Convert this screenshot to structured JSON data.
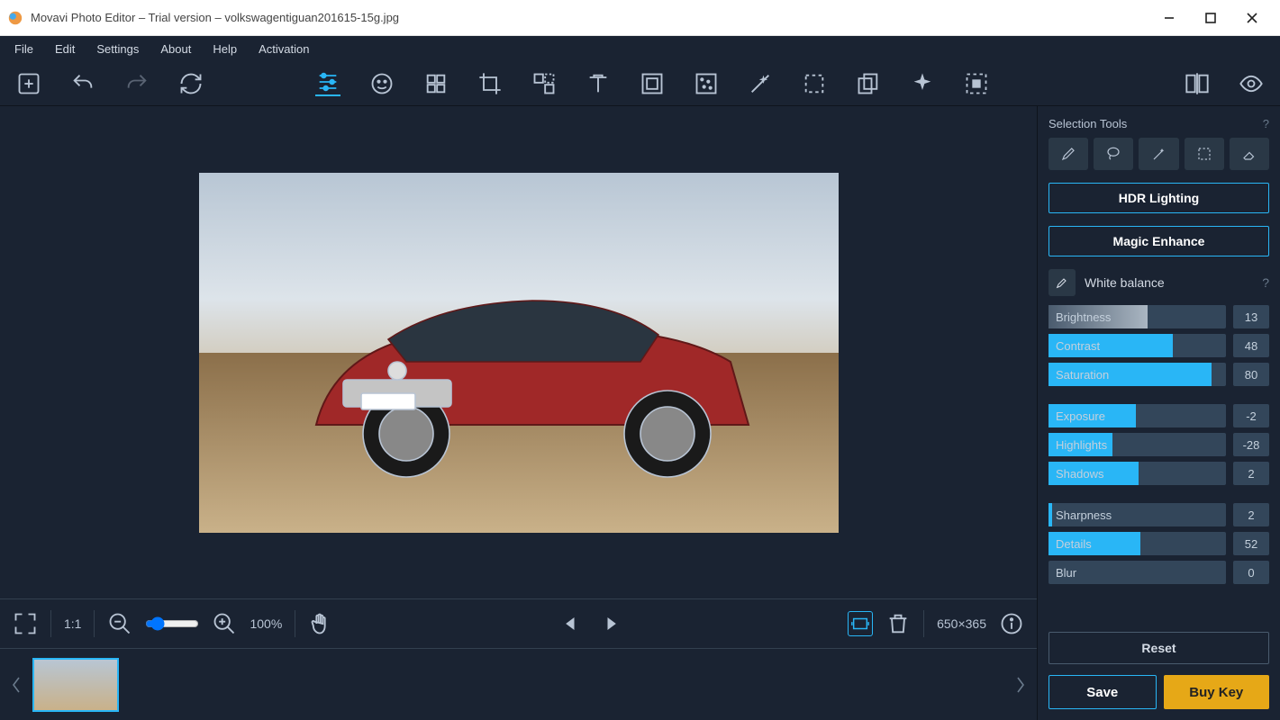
{
  "title": "Movavi Photo Editor – Trial version – volkswagentiguan201615-15g.jpg",
  "menu": [
    "File",
    "Edit",
    "Settings",
    "About",
    "Help",
    "Activation"
  ],
  "zoom": {
    "ratio": "1:1",
    "percent": "100%",
    "dimensions": "650×365"
  },
  "side": {
    "selection_title": "Selection Tools",
    "hdr": "HDR Lighting",
    "magic": "Magic Enhance",
    "wb": "White balance",
    "sliders1": [
      {
        "label": "Brightness",
        "val": "13",
        "fill": 56,
        "gray": true
      },
      {
        "label": "Contrast",
        "val": "48",
        "fill": 70
      },
      {
        "label": "Saturation",
        "val": "80",
        "fill": 92
      }
    ],
    "sliders2": [
      {
        "label": "Exposure",
        "val": "-2",
        "fill": 49
      },
      {
        "label": "Highlights",
        "val": "-28",
        "fill": 36
      },
      {
        "label": "Shadows",
        "val": "2",
        "fill": 51
      }
    ],
    "sliders3": [
      {
        "label": "Sharpness",
        "val": "2",
        "fill": 2
      },
      {
        "label": "Details",
        "val": "52",
        "fill": 52
      },
      {
        "label": "Blur",
        "val": "0",
        "fill": 0
      }
    ],
    "reset": "Reset",
    "save": "Save",
    "buy": "Buy Key"
  }
}
